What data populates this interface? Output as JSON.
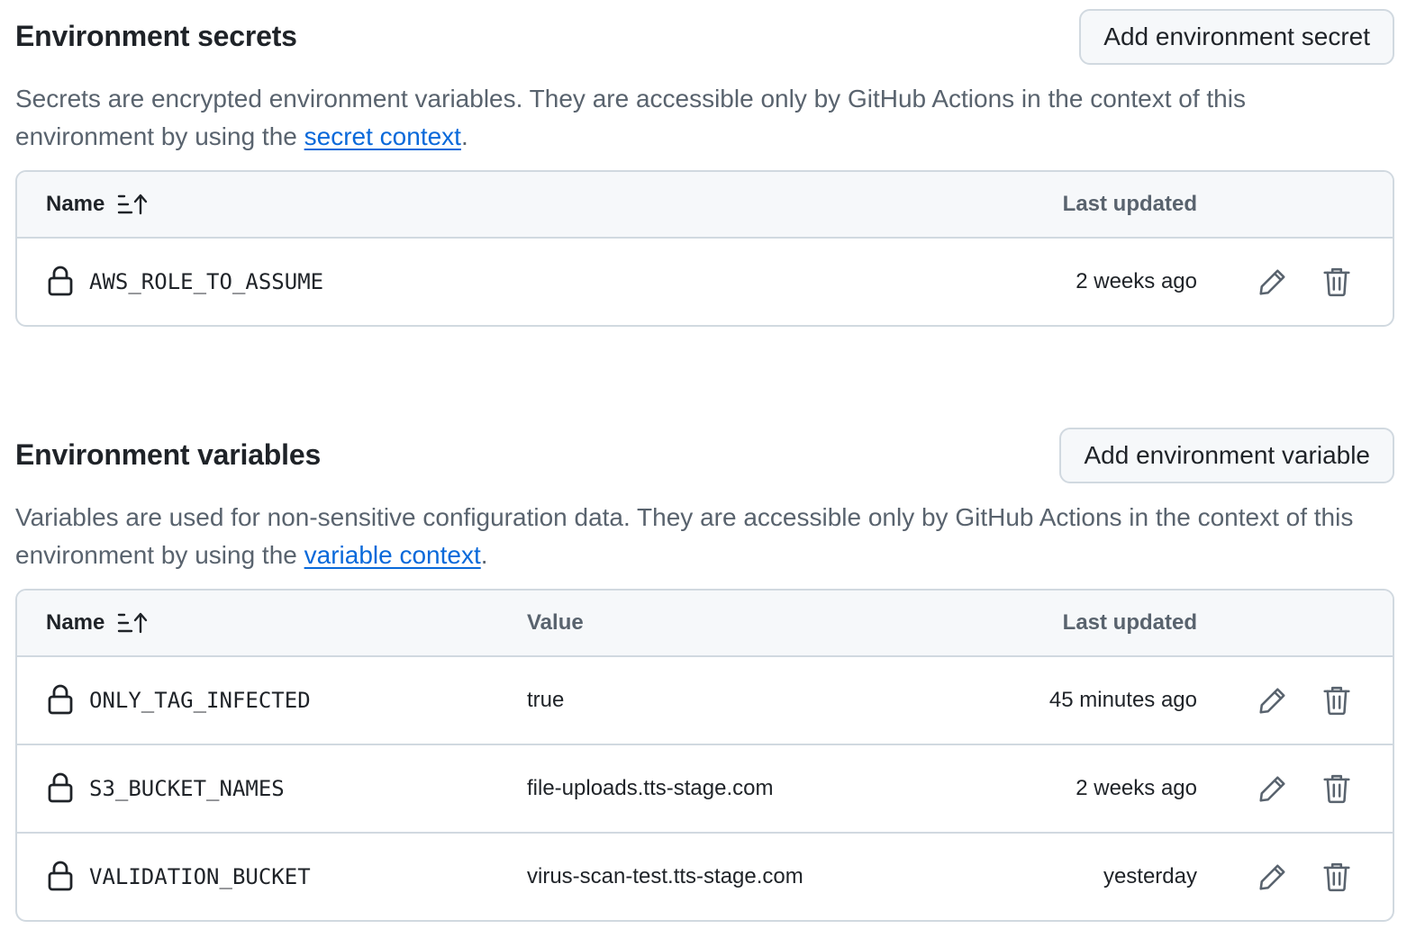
{
  "secrets": {
    "title": "Environment secrets",
    "add_button": "Add environment secret",
    "description_prefix": "Secrets are encrypted environment variables. They are accessible only by GitHub Actions in the context of this environment by using the ",
    "description_link": "secret context",
    "description_suffix": ".",
    "columns": {
      "name": "Name",
      "last_updated": "Last updated"
    },
    "rows": [
      {
        "name": "AWS_ROLE_TO_ASSUME",
        "last_updated": "2 weeks ago"
      }
    ]
  },
  "variables": {
    "title": "Environment variables",
    "add_button": "Add environment variable",
    "description_prefix": "Variables are used for non-sensitive configuration data. They are accessible only by GitHub Actions in the context of this environment by using the ",
    "description_link": "variable context",
    "description_suffix": ".",
    "columns": {
      "name": "Name",
      "value": "Value",
      "last_updated": "Last updated"
    },
    "rows": [
      {
        "name": "ONLY_TAG_INFECTED",
        "value": "true",
        "last_updated": "45 minutes ago"
      },
      {
        "name": "S3_BUCKET_NAMES",
        "value": "file-uploads.tts-stage.com",
        "last_updated": "2 weeks ago"
      },
      {
        "name": "VALIDATION_BUCKET",
        "value": "virus-scan-test.tts-stage.com",
        "last_updated": "yesterday"
      }
    ]
  },
  "icons": {
    "sort": "sort-ascending-icon",
    "lock": "lock-icon",
    "edit": "pencil-icon",
    "delete": "trash-icon"
  },
  "colors": {
    "link": "#0969da",
    "muted_text": "#59636e",
    "border": "#d1d9e0",
    "header_bg": "#f6f8fa"
  }
}
